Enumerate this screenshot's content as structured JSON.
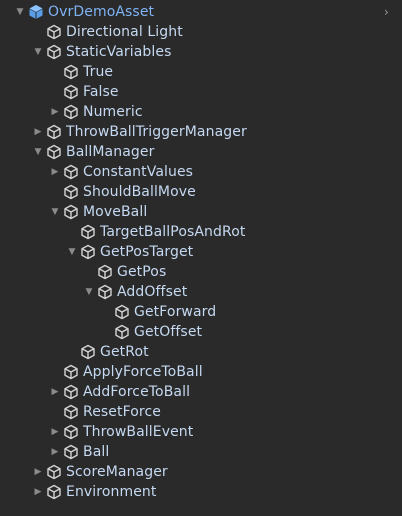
{
  "hierarchy": {
    "root": {
      "label": "OvrDemoAsset"
    },
    "items": [
      {
        "label": "Directional Light",
        "depth": 1,
        "arrow": "none"
      },
      {
        "label": "StaticVariables",
        "depth": 1,
        "arrow": "expanded"
      },
      {
        "label": "True",
        "depth": 2,
        "arrow": "none"
      },
      {
        "label": "False",
        "depth": 2,
        "arrow": "none"
      },
      {
        "label": "Numeric",
        "depth": 2,
        "arrow": "collapsed"
      },
      {
        "label": "ThrowBallTriggerManager",
        "depth": 1,
        "arrow": "collapsed"
      },
      {
        "label": "BallManager",
        "depth": 1,
        "arrow": "expanded"
      },
      {
        "label": "ConstantValues",
        "depth": 2,
        "arrow": "collapsed"
      },
      {
        "label": "ShouldBallMove",
        "depth": 2,
        "arrow": "none"
      },
      {
        "label": "MoveBall",
        "depth": 2,
        "arrow": "expanded"
      },
      {
        "label": "TargetBallPosAndRot",
        "depth": 3,
        "arrow": "none"
      },
      {
        "label": "GetPosTarget",
        "depth": 3,
        "arrow": "expanded"
      },
      {
        "label": "GetPos",
        "depth": 4,
        "arrow": "none"
      },
      {
        "label": "AddOffset",
        "depth": 4,
        "arrow": "expanded"
      },
      {
        "label": "GetForward",
        "depth": 5,
        "arrow": "none"
      },
      {
        "label": "GetOffset",
        "depth": 5,
        "arrow": "none"
      },
      {
        "label": "GetRot",
        "depth": 3,
        "arrow": "none"
      },
      {
        "label": "ApplyForceToBall",
        "depth": 2,
        "arrow": "none"
      },
      {
        "label": "AddForceToBall",
        "depth": 2,
        "arrow": "collapsed"
      },
      {
        "label": "ResetForce",
        "depth": 2,
        "arrow": "none"
      },
      {
        "label": "ThrowBallEvent",
        "depth": 2,
        "arrow": "collapsed"
      },
      {
        "label": "Ball",
        "depth": 2,
        "arrow": "collapsed"
      },
      {
        "label": "ScoreManager",
        "depth": 1,
        "arrow": "collapsed"
      },
      {
        "label": "Environment",
        "depth": 1,
        "arrow": "collapsed"
      }
    ]
  },
  "colors": {
    "background": "#2a2a2a",
    "label": "#c5d9f2",
    "root_label": "#7fb3f5",
    "prefab_icon": "#5b9ee8"
  }
}
